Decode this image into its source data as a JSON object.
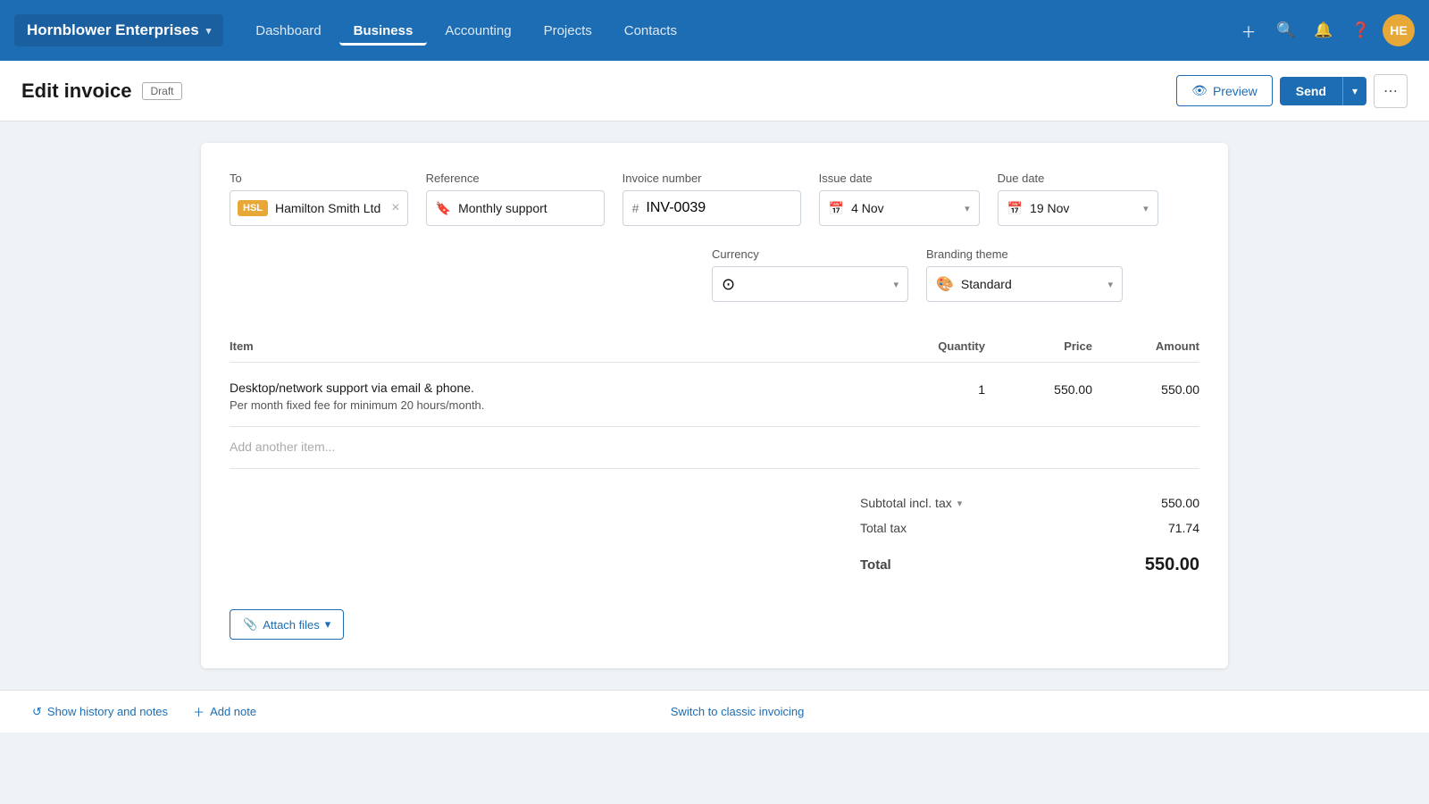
{
  "app": {
    "brand": "Hornblower Enterprises",
    "brand_chevron": "▾",
    "avatar_initials": "HE"
  },
  "nav": {
    "links": [
      {
        "label": "Dashboard",
        "active": false
      },
      {
        "label": "Business",
        "active": true
      },
      {
        "label": "Accounting",
        "active": false
      },
      {
        "label": "Projects",
        "active": false
      },
      {
        "label": "Contacts",
        "active": false
      }
    ]
  },
  "page": {
    "title": "Edit invoice",
    "status_badge": "Draft"
  },
  "header_actions": {
    "preview_label": "Preview",
    "send_label": "Send"
  },
  "invoice": {
    "to_badge": "HSL",
    "to_name": "Hamilton Smith Ltd",
    "reference_label": "Reference",
    "reference_value": "Monthly support",
    "invoice_number_label": "Invoice number",
    "invoice_number_value": "INV-0039",
    "issue_date_label": "Issue date",
    "issue_date_value": "4 Nov",
    "due_date_label": "Due date",
    "due_date_value": "19 Nov",
    "currency_label": "Currency",
    "currency_icon": "⊙",
    "branding_theme_label": "Branding theme",
    "branding_theme_value": "Standard",
    "columns": {
      "item": "Item",
      "quantity": "Quantity",
      "price": "Price",
      "amount": "Amount"
    },
    "line_items": [
      {
        "description": "Desktop/network support via email & phone.",
        "sub_description": "Per month fixed fee for minimum 20 hours/month.",
        "quantity": "1",
        "price": "550.00",
        "amount": "550.00"
      }
    ],
    "add_item_placeholder": "Add another item...",
    "subtotal_label": "Subtotal incl. tax",
    "subtotal_value": "550.00",
    "total_tax_label": "Total tax",
    "total_tax_value": "71.74",
    "total_label": "Total",
    "total_value": "550.00"
  },
  "footer": {
    "attach_files_label": "Attach files",
    "history_label": "Show history and notes",
    "add_note_label": "Add note",
    "classic_label": "Switch to classic invoicing"
  }
}
